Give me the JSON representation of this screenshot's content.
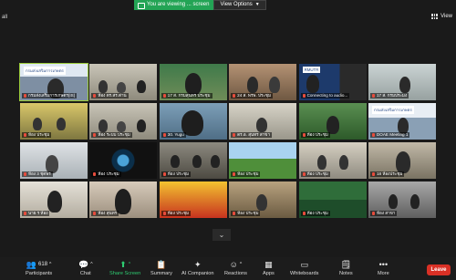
{
  "top_bar": {
    "banner_text": "You are viewing ... screen",
    "view_options_label": "View Options",
    "left_label": "all",
    "view_label": "View"
  },
  "tiles": [
    {
      "name": "กรมส่งเสริมการเกษตร(IS)",
      "sign": "กรมส่งเสริมการเกษตร",
      "theme": "blue",
      "active": true
    },
    {
      "name": "ห้อง ตร.สร.ต่าน",
      "theme": "office"
    },
    {
      "name": "17 ส. กรมสุนทร ประชุม",
      "theme": "green"
    },
    {
      "name": "24 ส. พรพ. ประชุม",
      "theme": "warm"
    },
    {
      "name": "Connecting to audio...",
      "sign": "RMUTR",
      "theme": "rmutr"
    },
    {
      "name": "17 ส. กรมประมง",
      "theme": "office2"
    },
    {
      "name": "ห้อง ประชุม",
      "theme": "yellow"
    },
    {
      "name": "ห้อง ระบบ ประชุม",
      "theme": "office"
    },
    {
      "name": "30. Yugu",
      "theme": "person"
    },
    {
      "name": "ดร.อ. สุนทร สาขา",
      "theme": "room"
    },
    {
      "name": "ห้อง ประชุม",
      "theme": "green2"
    },
    {
      "name": "DOAE Meeting 1",
      "sign": "กรมส่งเสริมการเกษตร",
      "theme": "blue2"
    },
    {
      "name": "ห้อง 3 ชุดพร",
      "theme": "office3"
    },
    {
      "name": "ห้อง ประชุม",
      "theme": "eye"
    },
    {
      "name": "ห้อง ประชุม",
      "theme": "room2"
    },
    {
      "name": "ห้อง ประชุม",
      "theme": "landscape"
    },
    {
      "name": "ห้อง ประชุม",
      "theme": "room3"
    },
    {
      "name": "18 ห้องประชุม",
      "theme": "person2"
    },
    {
      "name": "นาย ร ห้อง",
      "theme": "person3"
    },
    {
      "name": "ห้อง สุนทร",
      "theme": "person4"
    },
    {
      "name": "ห้อง ประชุม",
      "theme": "cartoon"
    },
    {
      "name": "ห้อง ประชุม",
      "theme": "warm2"
    },
    {
      "name": "ห้อง ประชุม",
      "theme": "banner"
    },
    {
      "name": "ห้อง สาขา",
      "theme": "room4"
    }
  ],
  "toolbar": {
    "participants_count": "618",
    "participants": "Participants",
    "chat": "Chat",
    "share_screen": "Share Screen",
    "summary": "Summary",
    "ai_companion": "AI Companion",
    "reactions": "Reactions",
    "apps": "Apps",
    "whiteboards": "Whiteboards",
    "notes": "Notes",
    "more": "More",
    "leave": "Leave"
  }
}
